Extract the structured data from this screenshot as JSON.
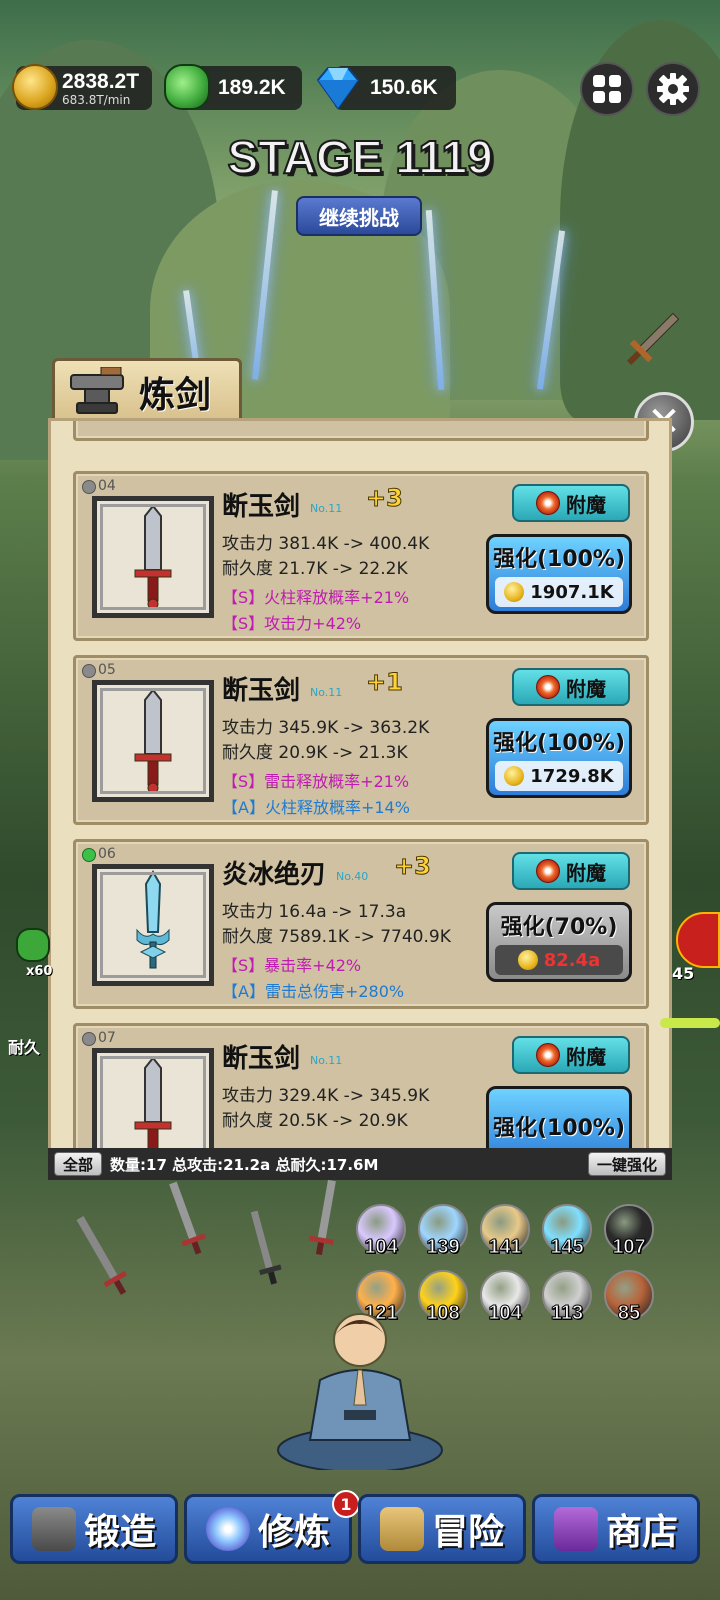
{
  "resources": {
    "gold": "2838.2T",
    "gold_rate": "683.8T/min",
    "jade": "189.2K",
    "gems": "150.6K"
  },
  "stage": {
    "title": "STAGE 1119",
    "continue_label": "继续挑战"
  },
  "panel": {
    "title": "炼剑",
    "items": [
      {
        "slot": "04",
        "name": "断玉剑",
        "level": "No.11",
        "plus": "+3",
        "attack": "攻击力 381.4K -> 400.4K",
        "durability": "耐久度 21.7K -> 22.2K",
        "attr1": "【S】火柱释放概率+21%",
        "attr2": "【S】攻击力+42%",
        "enchant_label": "附魔",
        "upgrade_label": "强化(100%)",
        "upgrade_cost": "1907.1K"
      },
      {
        "slot": "05",
        "name": "断玉剑",
        "level": "No.11",
        "plus": "+1",
        "attack": "攻击力 345.9K -> 363.2K",
        "durability": "耐久度 20.9K -> 21.3K",
        "attr1": "【S】雷击释放概率+21%",
        "attr2": "【A】火柱释放概率+14%",
        "enchant_label": "附魔",
        "upgrade_label": "强化(100%)",
        "upgrade_cost": "1729.8K"
      },
      {
        "slot": "06",
        "name": "炎冰绝刃",
        "level": "No.40",
        "plus": "+3",
        "attack": "攻击力 16.4a -> 17.3a",
        "durability": "耐久度 7589.1K -> 7740.9K",
        "attr1": "【S】暴击率+42%",
        "attr2": "【A】雷击总伤害+280%",
        "enchant_label": "附魔",
        "upgrade_label": "强化(70%)",
        "upgrade_cost": "82.4a"
      },
      {
        "slot": "07",
        "name": "断玉剑",
        "level": "No.11",
        "plus": "",
        "attack": "攻击力 329.4K -> 345.9K",
        "durability": "耐久度 20.5K -> 20.9K",
        "attr1": "",
        "attr2": "",
        "enchant_label": "附魔",
        "upgrade_label": "强化(100%)",
        "upgrade_cost": ""
      }
    ],
    "footer": {
      "all_label": "全部",
      "summary": "数量:17 总攻击:21.2a 总耐久:17.6M",
      "upgrade_all_label": "一键强化"
    }
  },
  "side": {
    "left_count": "x60",
    "durability_label": "耐久",
    "right_count": "45"
  },
  "materials": [
    {
      "count": "104",
      "color": "#d9c8ff"
    },
    {
      "count": "139",
      "color": "#9fd6ff"
    },
    {
      "count": "141",
      "color": "#e7c98a"
    },
    {
      "count": "145",
      "color": "#7fe0ff"
    },
    {
      "count": "107",
      "color": "#2a2a2a"
    },
    {
      "count": "121",
      "color": "#ffb04a"
    },
    {
      "count": "108",
      "color": "#ffd21a"
    },
    {
      "count": "104",
      "color": "#e8e8e8"
    },
    {
      "count": "113",
      "color": "#d0d0d0"
    },
    {
      "count": "85",
      "color": "#b8643a"
    }
  ],
  "nav": {
    "forge": "锻造",
    "cultivate": "修炼",
    "cultivate_badge": "1",
    "adventure": "冒险",
    "shop": "商店"
  }
}
